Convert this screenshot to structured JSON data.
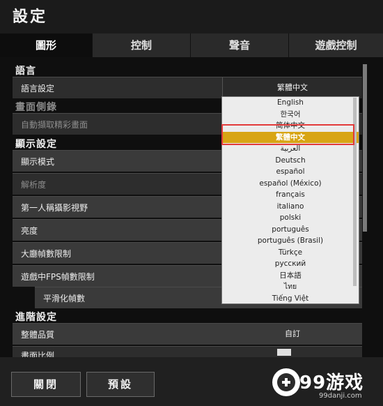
{
  "window": {
    "title": "設定"
  },
  "tabs": [
    {
      "label": "圖形",
      "active": true
    },
    {
      "label": "控制",
      "active": false
    },
    {
      "label": "聲音",
      "active": false
    },
    {
      "label": "遊戲控制",
      "active": false
    }
  ],
  "sections": {
    "language": "語言",
    "capture": "畫面側錄",
    "display": "顯示設定",
    "advanced": "進階設定"
  },
  "rows": {
    "language_setting": {
      "label": "語言設定",
      "value": "繁體中文"
    },
    "auto_capture": {
      "label": "自動擷取精彩畫面"
    },
    "display_mode": {
      "label": "顯示模式"
    },
    "resolution": {
      "label": "解析度"
    },
    "fov": {
      "label": "第一人稱攝影視野"
    },
    "brightness": {
      "label": "亮度"
    },
    "lobby_fps": {
      "label": "大廳幀數限制"
    },
    "ingame_fps": {
      "label": "遊戲中FPS幀數限制"
    },
    "smoothing": {
      "label": "平滑化幀數"
    },
    "overall_quality": {
      "label": "整體品質",
      "value": "自訂"
    },
    "screen_scale": {
      "label": "畫面比例"
    }
  },
  "dropdown": {
    "options": [
      "English",
      "한국어",
      "简体中文",
      "繁體中文",
      "العربية",
      "Deutsch",
      "español",
      "español (México)",
      "français",
      "italiano",
      "polski",
      "português",
      "português (Brasil)",
      "Türkçe",
      "русский",
      "日本語",
      "ไทย",
      "Tiếng Việt"
    ],
    "selected": "繁體中文"
  },
  "buttons": {
    "close": "關閉",
    "default": "預設"
  },
  "watermark": {
    "logo_text": "99游戏",
    "url": "99danji.com"
  },
  "colors": {
    "accent": "#d8a514",
    "highlight_box": "#e23a3a"
  }
}
